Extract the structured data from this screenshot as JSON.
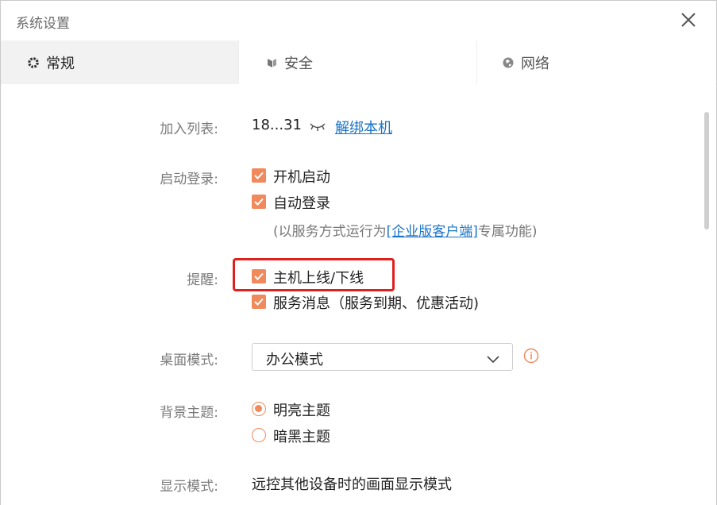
{
  "window": {
    "title": "系统设置"
  },
  "tabs": [
    {
      "label": "常规",
      "icon": "gear-icon",
      "active": true
    },
    {
      "label": "安全",
      "icon": "shield-icon",
      "active": false
    },
    {
      "label": "网络",
      "icon": "globe-icon",
      "active": false
    }
  ],
  "settings": {
    "join_list": {
      "label": "加入列表:",
      "value": "18...31",
      "unbind_link": "解绑本机"
    },
    "startup": {
      "label": "启动登录:",
      "auto_start": "开机启动",
      "auto_login": "自动登录",
      "note_prefix": "(以服务方式运行为",
      "note_link": "[企业版客户端]",
      "note_suffix": "专属功能)"
    },
    "reminder": {
      "label": "提醒:",
      "host_online": "主机上线/下线",
      "service_msg": "服务消息（服务到期、优惠活动)"
    },
    "desktop_mode": {
      "label": "桌面模式:",
      "selected": "办公模式"
    },
    "theme": {
      "label": "背景主题:",
      "light": "明亮主题",
      "dark": "暗黑主题",
      "selected": "light"
    },
    "display_mode": {
      "label": "显示模式:",
      "desc": "远控其他设备时的画面显示模式"
    }
  },
  "colors": {
    "accent": "#f08a5d",
    "highlight_border": "#e0201f",
    "link": "#1a73c8"
  }
}
